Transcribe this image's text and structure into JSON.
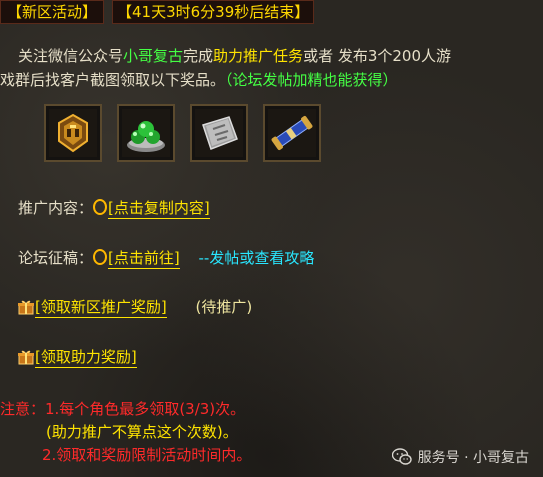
{
  "header": {
    "tag": "【新区活动】",
    "countdown": "【41天3时6分39秒后结束】"
  },
  "description": {
    "p1": "关注微信公众号",
    "account": "小哥复古",
    "p2": "完成",
    "task": "助力推广任务",
    "p3": "或者 发布3个200人游",
    "p4": "戏群后找客户截图领取以下奖品。",
    "hint": "（论坛发帖加精也能获得）"
  },
  "rewards": [
    {
      "icon": "golden-mask-icon"
    },
    {
      "icon": "green-gem-pile-icon"
    },
    {
      "icon": "silver-book-icon"
    },
    {
      "icon": "scroll-icon"
    }
  ],
  "promo": {
    "label": "推广内容：",
    "link": "[点击复制内容]"
  },
  "forum": {
    "label": "论坛征稿：",
    "link": "[点击前往]",
    "note": "--发帖或查看攻略"
  },
  "claim_new": {
    "link": "[领取新区推广奖励]",
    "status": "(待推广)"
  },
  "claim_help": {
    "link": "[领取助力奖励]"
  },
  "notes": {
    "line1": "注意：1.每个角色最多领取(3/3)次。",
    "line2": "(助力推广不算点这个次数)。",
    "line3": "2.领取和奖励限制活动时间内。"
  },
  "watermark": {
    "text": "服务号 · 小哥复古"
  },
  "colors": {
    "accent_yellow": "#ffe400",
    "green": "#44ff44",
    "cyan": "#29e7ff",
    "red": "#ff2a2a"
  }
}
